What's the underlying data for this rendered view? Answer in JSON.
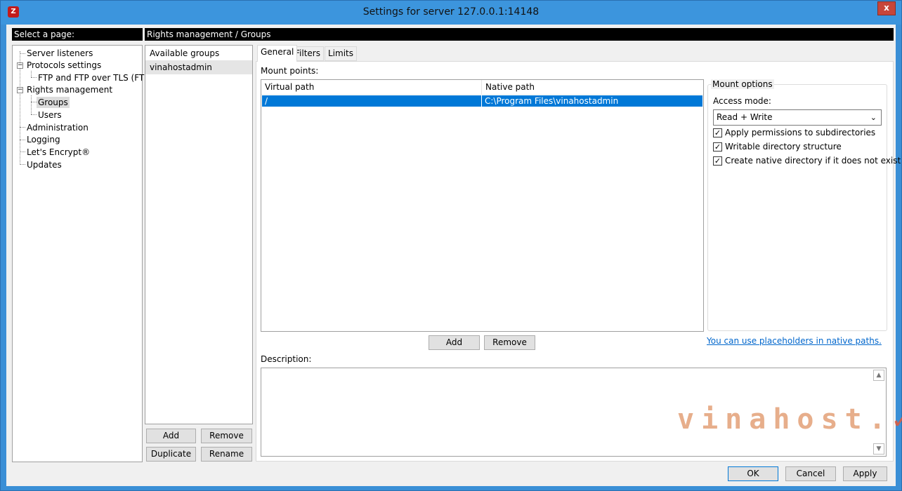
{
  "window": {
    "title": "Settings for server 127.0.0.1:14148",
    "close": "x",
    "app_icon": "Z"
  },
  "left_header": "Select a page:",
  "right_header": "Rights management / Groups",
  "tree": {
    "server_listeners": "Server listeners",
    "protocols": "Protocols settings",
    "ftp": "FTP and FTP over TLS (FTPS)",
    "rights": "Rights management",
    "groups": "Groups",
    "users": "Users",
    "administration": "Administration",
    "logging": "Logging",
    "letsencrypt": "Let's Encrypt®",
    "updates": "Updates"
  },
  "groups": {
    "header": "Available groups",
    "items": [
      "vinahostadmin"
    ]
  },
  "group_buttons": {
    "add": "Add",
    "remove": "Remove",
    "duplicate": "Duplicate",
    "rename": "Rename"
  },
  "tabs": [
    "General",
    "Filters",
    "Limits"
  ],
  "mount_points": {
    "label": "Mount points:",
    "columns": [
      "Virtual path",
      "Native path"
    ],
    "rows": [
      {
        "virtual": "/",
        "native": "C:\\Program Files\\vinahostadmin"
      }
    ],
    "add": "Add",
    "remove": "Remove"
  },
  "mount_options": {
    "legend": "Mount options",
    "access_mode_label": "Access mode:",
    "access_mode_value": "Read + Write",
    "checks": [
      {
        "label": "Apply permissions to subdirectories",
        "checked": true
      },
      {
        "label": "Writable directory structure",
        "checked": true
      },
      {
        "label": "Create native directory if it does not exist",
        "checked": true
      }
    ],
    "placeholders_link": "You can use placeholders in native paths."
  },
  "description": {
    "label": "Description:",
    "value": ""
  },
  "watermark": "vinahost.",
  "footer": {
    "ok": "OK",
    "cancel": "Cancel",
    "apply": "Apply"
  }
}
